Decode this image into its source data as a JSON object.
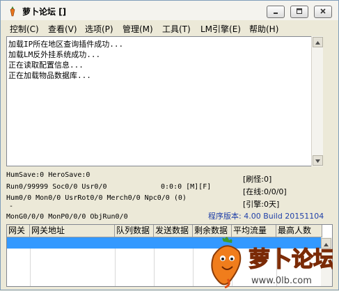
{
  "window": {
    "title": "萝卜论坛 []",
    "controls": {
      "minimize": "minimize-icon",
      "maximize": "maximize-icon",
      "close": "close-icon"
    }
  },
  "menu": [
    {
      "label": "控制(C)"
    },
    {
      "label": "查看(V)"
    },
    {
      "label": "选项(P)"
    },
    {
      "label": "管理(M)"
    },
    {
      "label": "工具(T)"
    },
    {
      "label": "LM引擎(E)"
    },
    {
      "label": "帮助(H)"
    }
  ],
  "log": [
    "加载IP所在地区查询插件成功...",
    "加载LM反外挂系统成功...",
    "正在读取配置信息...",
    "正在加载物品数据库..."
  ],
  "status": {
    "line1": "HumSave:0 HeroSave:0",
    "line2": "Run0/99999 Soc0/0 Usr0/0",
    "line2_right": "0:0:0 [M][F]",
    "line3": "Hum0/0 Mon0/0 UsrRot0/0 Merch0/0 Npc0/0 (0)",
    "line4": "-",
    "line5": "MonG0/0/0 MonP0/0/0 ObjRun0/0",
    "refresh": "[刷怪:0]",
    "online": "[在线:0/0/0]",
    "engine": "[引擎:0天]",
    "version": "程序版本: 4.00 Build 20151104"
  },
  "table": {
    "headers": [
      "网关",
      "网关地址",
      "队列数据",
      "发送数据",
      "剩余数据",
      "平均流量",
      "最高人数"
    ]
  },
  "watermark": {
    "logo_text": "萝卜论坛",
    "url": "www.0lb.com"
  },
  "colors": {
    "selection": "#3399ff",
    "version_text": "#1f3fa8",
    "window_bg": "#ece9d8"
  }
}
